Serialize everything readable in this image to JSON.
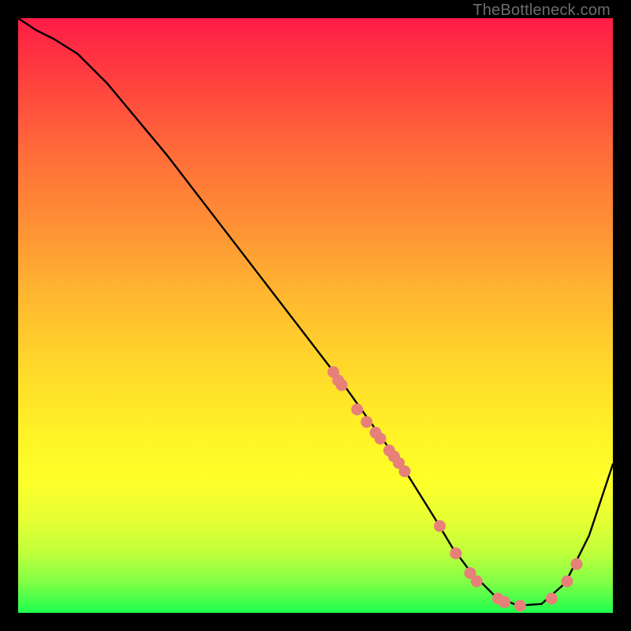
{
  "attribution": "TheBottleneck.com",
  "chart_data": {
    "type": "line",
    "title": "",
    "xlabel": "",
    "ylabel": "",
    "xlim": [
      0,
      100
    ],
    "ylim": [
      0,
      100
    ],
    "grid": false,
    "series": [
      {
        "name": "curve",
        "x": [
          0,
          3,
          6,
          10,
          15,
          20,
          25,
          30,
          35,
          40,
          45,
          50,
          55,
          60,
          65,
          70,
          73,
          76,
          80,
          84,
          88,
          92,
          96,
          100
        ],
        "y": [
          100,
          98,
          96.5,
          94,
          89,
          83,
          77,
          70.5,
          64,
          57.5,
          51,
          44.5,
          38,
          31,
          24,
          16,
          11,
          7,
          3,
          1.2,
          1.5,
          5,
          13,
          25
        ]
      }
    ],
    "scatter": [
      {
        "name": "markers",
        "points": [
          {
            "x": 53,
            "y": 40.5
          },
          {
            "x": 53.8,
            "y": 39.1
          },
          {
            "x": 54.4,
            "y": 38.3
          },
          {
            "x": 57.0,
            "y": 34.2
          },
          {
            "x": 58.6,
            "y": 32.1
          },
          {
            "x": 60.1,
            "y": 30.3
          },
          {
            "x": 60.9,
            "y": 29.3
          },
          {
            "x": 62.4,
            "y": 27.3
          },
          {
            "x": 63.2,
            "y": 26.3
          },
          {
            "x": 64.0,
            "y": 25.2
          },
          {
            "x": 65.0,
            "y": 23.8
          },
          {
            "x": 70.9,
            "y": 14.6
          },
          {
            "x": 73.6,
            "y": 10.0
          },
          {
            "x": 76.0,
            "y": 6.7
          },
          {
            "x": 77.1,
            "y": 5.3
          },
          {
            "x": 80.7,
            "y": 2.4
          },
          {
            "x": 81.8,
            "y": 1.8
          },
          {
            "x": 84.4,
            "y": 1.2
          },
          {
            "x": 89.7,
            "y": 2.4
          },
          {
            "x": 92.3,
            "y": 5.3
          },
          {
            "x": 93.9,
            "y": 8.2
          }
        ],
        "dot_radius": 7.5
      }
    ],
    "background_gradient": {
      "top": "#ff1c47",
      "mid": "#ffe228",
      "bottom": "#1eff4e"
    }
  }
}
